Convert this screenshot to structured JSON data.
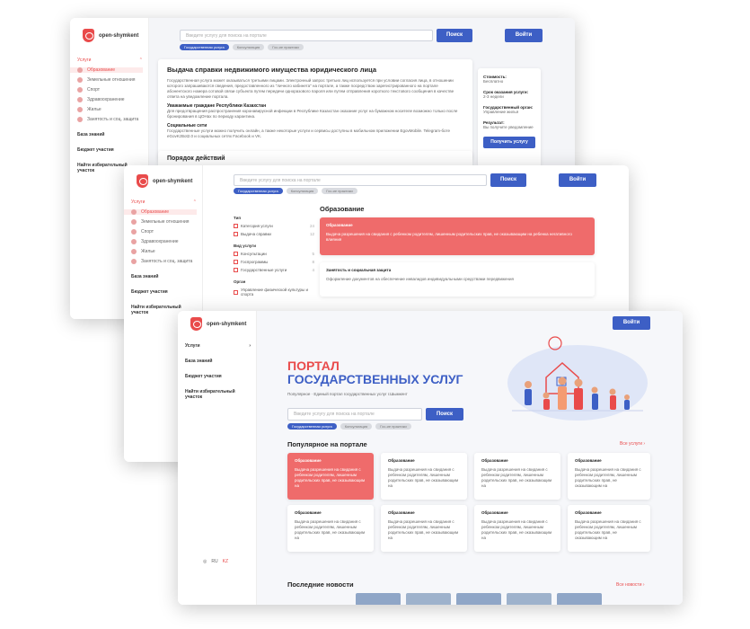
{
  "app": {
    "brand": "open-shymkent",
    "search_placeholder": "Введите услугу для поиска на портале",
    "search_button": "Поиск",
    "login_button": "Войти",
    "lang_ru": "RU",
    "lang_kz": "KZ"
  },
  "chips": [
    "Государственная услуга",
    "Консультация",
    "Гос-ие практики"
  ],
  "nav": {
    "group": "Услуги",
    "items": [
      "Образование",
      "Земельные отношения",
      "Спорт",
      "Здравоохранение",
      "Жилье",
      "Занятость и соц. защита"
    ],
    "sections": [
      "База знаний",
      "Бюджет участия",
      "Найти избирательный участок"
    ]
  },
  "w1": {
    "title": "Выдача справки недвижимого имущества юридического лица",
    "p1": "Государственная услуга может оказываться третьими лицами. Электронный запрос третьих лиц используется при условии согласия лица, в отношении которого запрашиваются сведения, предоставленного из \"личного кабинета\" на портале, а также посредством зарегистрированного на портале абонентского номера сотовой связи субъекта путем передачи одноразового пароля или путем отправления короткого текстового сообщения в качестве ответа на уведомление портала.",
    "h2": "Уважаемые граждане Республики Казахстан",
    "p2": "Для предотвращения распространения коронавирусной инфекции в Республике Казахстан оказание услуг на бумажном носителе возможно только после бронирования в ЦОНах по периоду карантина.",
    "h3": "Социальные сети",
    "p3": "Государственные услуги можно получить онлайн, а также некоторые услуги и сервисы доступны в мобильном приложении EgovMobile. Telegram-боте eGovKzBot2.0 и социальных сетях Facebook и VK.",
    "order_heading": "Порядок действий",
    "info": [
      {
        "label": "Стоимость:",
        "value": "Бесплатно"
      },
      {
        "label": "Срок оказания услуги:",
        "value": "2-3 недели"
      },
      {
        "label": "Государственный орган:",
        "value": "Управление жилья"
      },
      {
        "label": "Результат:",
        "value": "Вы получите уведомление"
      }
    ],
    "get_button": "Получить услугу"
  },
  "w2": {
    "heading": "Образование",
    "filters": [
      {
        "title": "Тип",
        "options": [
          {
            "label": "Категория услуги",
            "count": "24",
            "checked": true
          },
          {
            "label": "Выдача справки",
            "count": "12",
            "checked": false
          }
        ]
      },
      {
        "title": "Вид услуги",
        "options": [
          {
            "label": "Консультации",
            "count": "5",
            "checked": false
          },
          {
            "label": "Госпрограммы",
            "count": "8",
            "checked": false
          },
          {
            "label": "Государственные услуги",
            "count": "4",
            "checked": false
          }
        ]
      },
      {
        "title": "Орган",
        "options": [
          {
            "label": "Управление физической культуры и спорта",
            "count": "",
            "checked": false
          }
        ]
      }
    ],
    "cards": [
      {
        "title": "Образование",
        "desc": "Выдача разрешения на свидания с ребенком родителям, лишенным родительских прав, не оказывающим на ребенка негативного влияния",
        "active": true
      },
      {
        "title": "Занятость и социальная защита",
        "desc": "Оформление документов на обеспечение инвалидов индивидуальными средствами передвижения",
        "active": false
      }
    ]
  },
  "w3": {
    "hero_line1": "ПОРТАЛ",
    "hero_line2": "ГОСУДАРСТВЕННЫХ УСЛУГ",
    "breadcrumb": "Популярное · Единый портал государственных услуг г.Шымкент",
    "popular_heading": "Популярное на портале",
    "all_services": "Все услуги",
    "cards": [
      {
        "cat": "Образование",
        "desc": "Выдача разрешения на свидания с ребенком родителям, лишенным родительских прав, не оказывающим на",
        "active": true
      },
      {
        "cat": "Образование",
        "desc": "Выдача разрешения на свидания с ребенком родителям, лишенным родительских прав, не оказывающим на",
        "active": false
      },
      {
        "cat": "Образование",
        "desc": "Выдача разрешения на свидания с ребенком родителям, лишенным родительских прав, не оказывающим на",
        "active": false
      },
      {
        "cat": "Образование",
        "desc": "Выдача разрешения на свидания с ребенком родителям, лишенным родительских прав, не оказывающим на",
        "active": false
      },
      {
        "cat": "Образование",
        "desc": "Выдача разрешения на свидания с ребенком родителям, лишенным родительских прав, не оказывающим на",
        "active": false
      },
      {
        "cat": "Образование",
        "desc": "Выдача разрешения на свидания с ребенком родителям, лишенным родительских прав, не оказывающим на",
        "active": false
      },
      {
        "cat": "Образование",
        "desc": "Выдача разрешения на свидания с ребенком родителям, лишенным родительских прав, не оказывающим на",
        "active": false
      },
      {
        "cat": "Образование",
        "desc": "Выдача разрешения на свидания с ребенком родителям, лишенным родительских прав, не оказывающим на",
        "active": false
      }
    ],
    "news_heading": "Последние новости",
    "all_news": "Все новости"
  },
  "colors": {
    "accent": "#3d5fc5",
    "brand": "#e94b4b",
    "card_active": "#ef6b6b"
  }
}
